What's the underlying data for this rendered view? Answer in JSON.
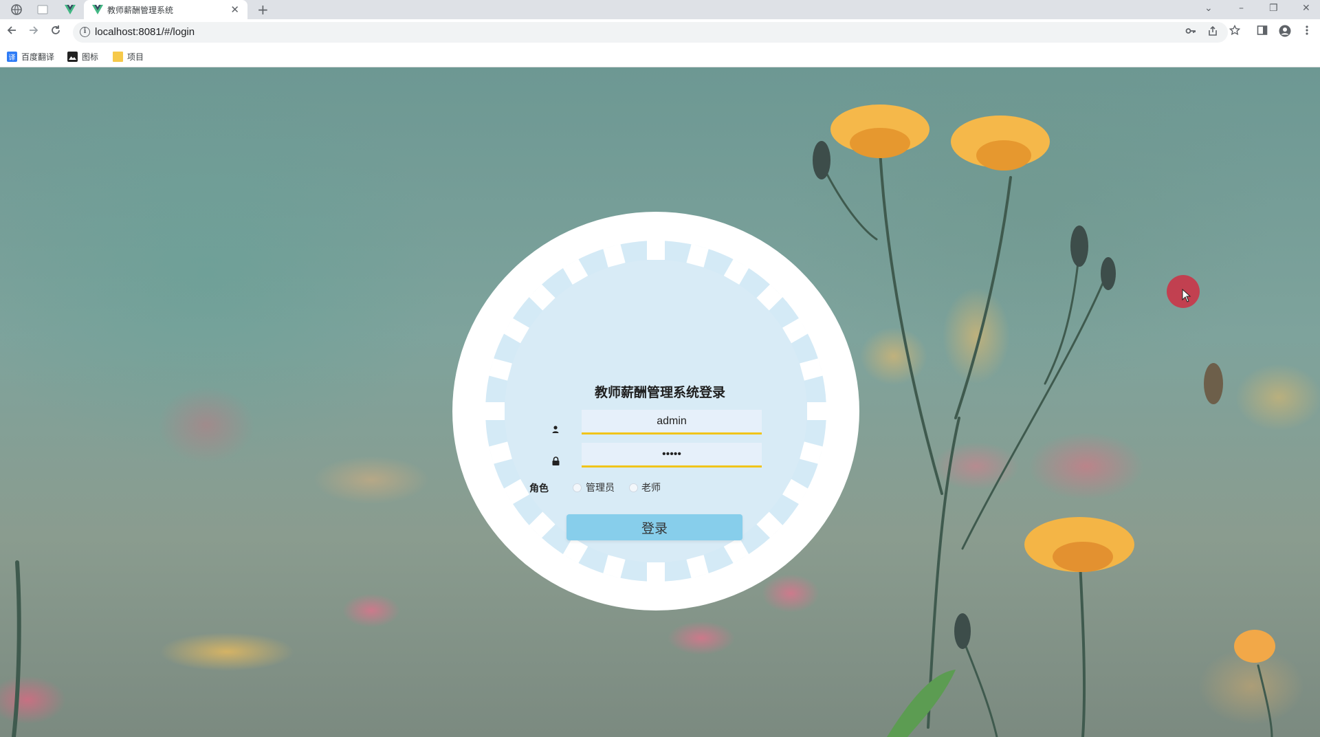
{
  "browser": {
    "active_tab_title": "教师薪酬管理系统",
    "tab_close": "✕",
    "new_tab": "+",
    "url": "localhost:8081/#/login",
    "window_controls": [
      "⌄",
      "–",
      "❐",
      "✕"
    ],
    "bookmarks": [
      {
        "label": "百度翻译",
        "icon": "baidu-translate-icon",
        "color": "#2f7cf6"
      },
      {
        "label": "图标",
        "icon": "image-icon",
        "color": "#222222"
      },
      {
        "label": "项目",
        "icon": "folder-icon",
        "color": "#f6c94a"
      }
    ]
  },
  "login": {
    "title": "教师薪酬管理系统登录",
    "username_value": "admin",
    "password_value": "•••••",
    "role_label": "角色",
    "role_options": [
      "管理员",
      "老师"
    ],
    "submit_label": "登录"
  },
  "colors": {
    "accent_underline": "#f0c419",
    "button": "#87ceeb",
    "panel": "#d4eaf6",
    "cursor_highlight": "#c8374a"
  }
}
